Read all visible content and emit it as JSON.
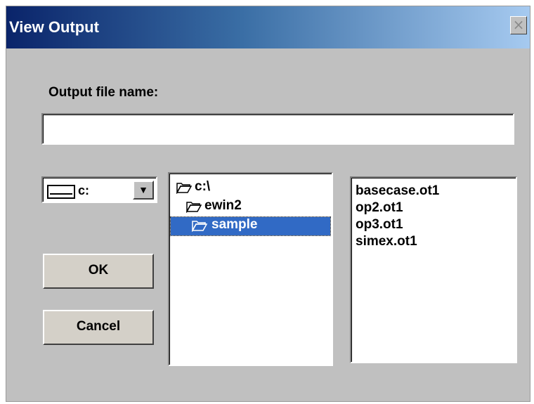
{
  "window": {
    "title": "View Output",
    "close_symbol": "×"
  },
  "form": {
    "filename_label": "Output file name:",
    "filename_value": "",
    "drive": {
      "selected": "c:",
      "arrow": "▼",
      "icon": "drive-icon"
    },
    "buttons": {
      "ok": "OK",
      "cancel": "Cancel"
    }
  },
  "directories": [
    {
      "name": "c:\\",
      "icon": "open-folder-icon",
      "selected": false
    },
    {
      "name": "ewin2",
      "icon": "open-folder-icon",
      "selected": false
    },
    {
      "name": "sample",
      "icon": "open-folder-icon",
      "selected": true
    }
  ],
  "files": [
    "basecase.ot1",
    "op2.ot1",
    "op3.ot1",
    "simex.ot1"
  ],
  "colors": {
    "selection": "#316ac5",
    "dialog_bg": "#c0c0c0"
  }
}
